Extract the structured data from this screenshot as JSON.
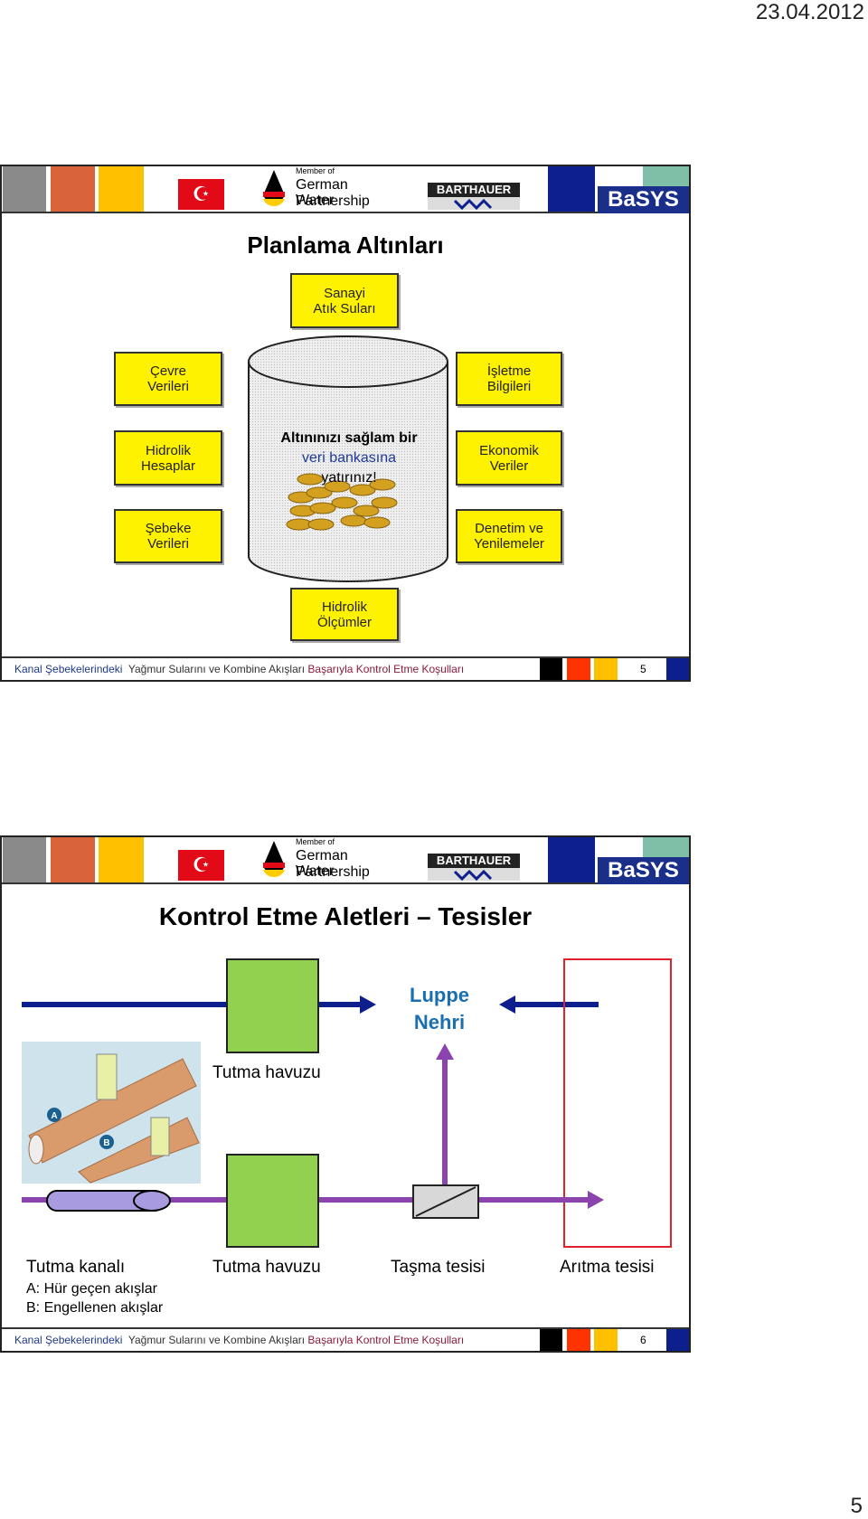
{
  "page": {
    "date": "23.04.2012",
    "number": "5"
  },
  "header": {
    "member_of": "Member of",
    "gwp_line1": "German Water",
    "gwp_line2": "Partnership",
    "barthauer": "BARTHAUER",
    "basys": "BaSYS"
  },
  "footer": {
    "part1": "Kanal Şebekelerindeki",
    "part2": "Yağmur Sularını ve Kombine Akışları",
    "part3": "Başarıyla Kontrol Etme Koşulları"
  },
  "slide1": {
    "title": "Planlama Altınları",
    "page": "5",
    "boxes": [
      [
        "Sanayi",
        "Atık Suları"
      ],
      [
        "Çevre",
        "Verileri"
      ],
      [
        "İşletme",
        "Bilgileri"
      ],
      [
        "Hidrolik",
        "Hesaplar"
      ],
      [
        "Ekonomik",
        "Veriler"
      ],
      [
        "Şebeke",
        "Verileri"
      ],
      [
        "Denetim ve",
        "Yenilemeler"
      ],
      [
        "Hidrolik",
        "Ölçümler"
      ]
    ],
    "cylinder": {
      "line1": "Altınınızı sağlam bir",
      "line2": "veri bankasına",
      "line3": "yatırınız!"
    }
  },
  "slide2": {
    "title": "Kontrol Etme Aletleri – Tesisler",
    "page": "6",
    "river": [
      "Luppe",
      "Nehri"
    ],
    "basin_label_top": "Tutma havuzu",
    "labels": {
      "canal": "Tutma kanalı",
      "basin": "Tutma havuzu",
      "overflow": "Taşma tesisi",
      "treatment": "Arıtma tesisi"
    },
    "legend": {
      "a": "A: Hür geçen akışlar",
      "b": "B: Engellenen akışlar"
    },
    "image_markers": [
      "A",
      "B"
    ]
  },
  "colors": {
    "navy": "#0d1f8c",
    "purple": "#8b44ad",
    "green": "#92d050",
    "red": "#e0202a",
    "yellow": "#fff200",
    "river": "#1a6fb0"
  }
}
